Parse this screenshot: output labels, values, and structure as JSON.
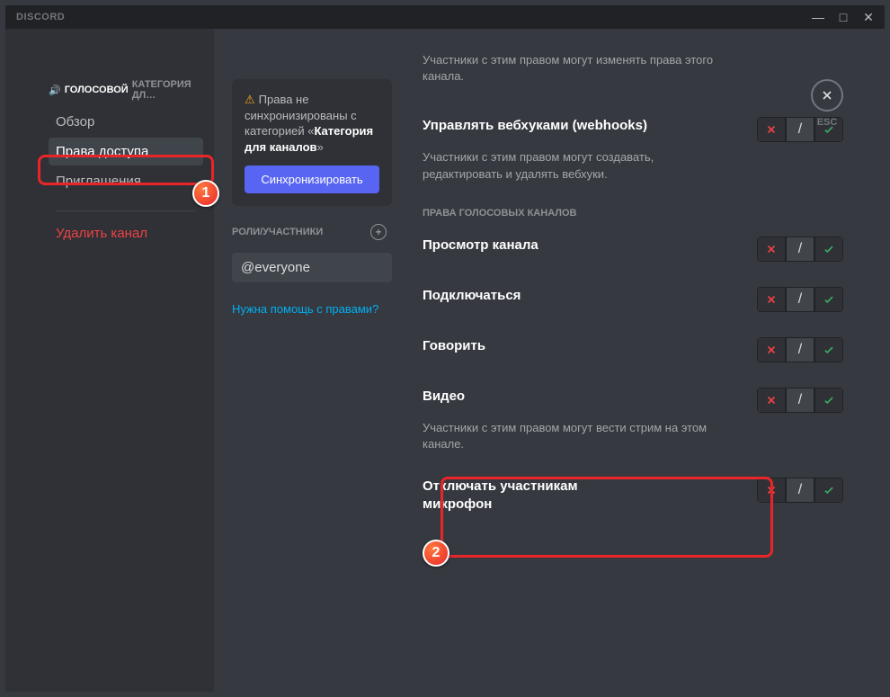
{
  "app": {
    "name": "DISCORD"
  },
  "window": {
    "min": "—",
    "max": "□",
    "close": "✕",
    "esc": "ESC"
  },
  "sidebar": {
    "heading_icon": "🔊",
    "heading": "ГОЛОСОВОЙ",
    "heading_suffix": "КАТЕГОРИЯ ДЛ…",
    "items": [
      {
        "label": "Обзор"
      },
      {
        "label": "Права доступа"
      },
      {
        "label": "Приглашения"
      }
    ],
    "delete": "Удалить канал"
  },
  "sync": {
    "prefix": "Права не синхронизированы с категорией «",
    "category": "Категория для каналов",
    "suffix": "»",
    "button": "Синхронизировать"
  },
  "roles": {
    "heading": "РОЛИ/УЧАСТНИКИ",
    "everyone": "@everyone",
    "help": "Нужна помощь с правами?"
  },
  "perms": {
    "topdesc": "Участники с этим правом могут изменять права этого канала.",
    "webhooks": {
      "title": "Управлять вебхуками (webhooks)",
      "desc": "Участники с этим правом могут создавать, редактировать и удалять вебхуки."
    },
    "section": "ПРАВА ГОЛОСОВЫХ КАНАЛОВ",
    "view": "Просмотр канала",
    "connect": "Подключаться",
    "speak": "Говорить",
    "video": {
      "title": "Видео",
      "desc": "Участники с этим правом могут вести стрим на этом канале."
    },
    "mute": "Отключать участникам микрофон"
  },
  "slash": "/"
}
